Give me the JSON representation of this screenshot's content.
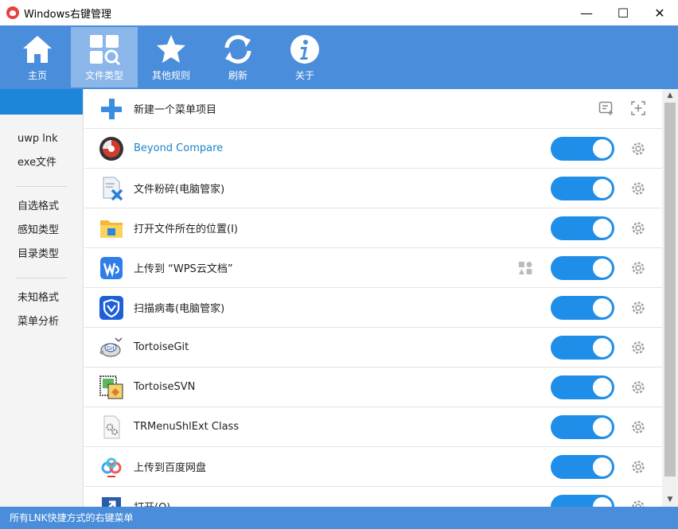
{
  "window": {
    "title": "Windows右键管理",
    "minimize": "—",
    "maximize": "☐",
    "close": "✕"
  },
  "toolbar": {
    "items": [
      {
        "label": "主页",
        "icon": "home-icon"
      },
      {
        "label": "文件类型",
        "icon": "file-type-icon",
        "active": true
      },
      {
        "label": "其他规则",
        "icon": "star-icon"
      },
      {
        "label": "刷新",
        "icon": "refresh-icon"
      },
      {
        "label": "关于",
        "icon": "info-icon"
      }
    ]
  },
  "sidebar": {
    "group1": [
      "uwp lnk",
      "exe文件"
    ],
    "group2": [
      "自选格式",
      "感知类型",
      "目录类型"
    ],
    "group3": [
      "未知格式",
      "菜单分析"
    ]
  },
  "content": {
    "new_item": "新建一个菜单项目",
    "rows": [
      {
        "label": "Beyond Compare",
        "icon": "beyond-compare-icon",
        "link": true
      },
      {
        "label": "文件粉碎(电脑管家)",
        "icon": "file-shred-icon"
      },
      {
        "label": "打开文件所在的位置(I)",
        "icon": "folder-icon"
      },
      {
        "label": "上传到 “WPS云文档”",
        "icon": "wps-icon"
      },
      {
        "label": "扫描病毒(电脑管家)",
        "icon": "virus-scan-icon"
      },
      {
        "label": "TortoiseGit",
        "icon": "tortoisegit-icon"
      },
      {
        "label": "TortoiseSVN",
        "icon": "tortoisesvn-icon"
      },
      {
        "label": "TRMenuShlExt Class",
        "icon": "trmenu-icon"
      },
      {
        "label": "上传到百度网盘",
        "icon": "baidu-netdisk-icon"
      },
      {
        "label": "打开(O)",
        "icon": "open-icon"
      }
    ]
  },
  "statusbar": {
    "text": "所有LNK快捷方式的右键菜单"
  },
  "colors": {
    "accent": "#4a8edb",
    "toggle_on": "#1f8ee8",
    "sidebar_active": "#1d86d9"
  }
}
